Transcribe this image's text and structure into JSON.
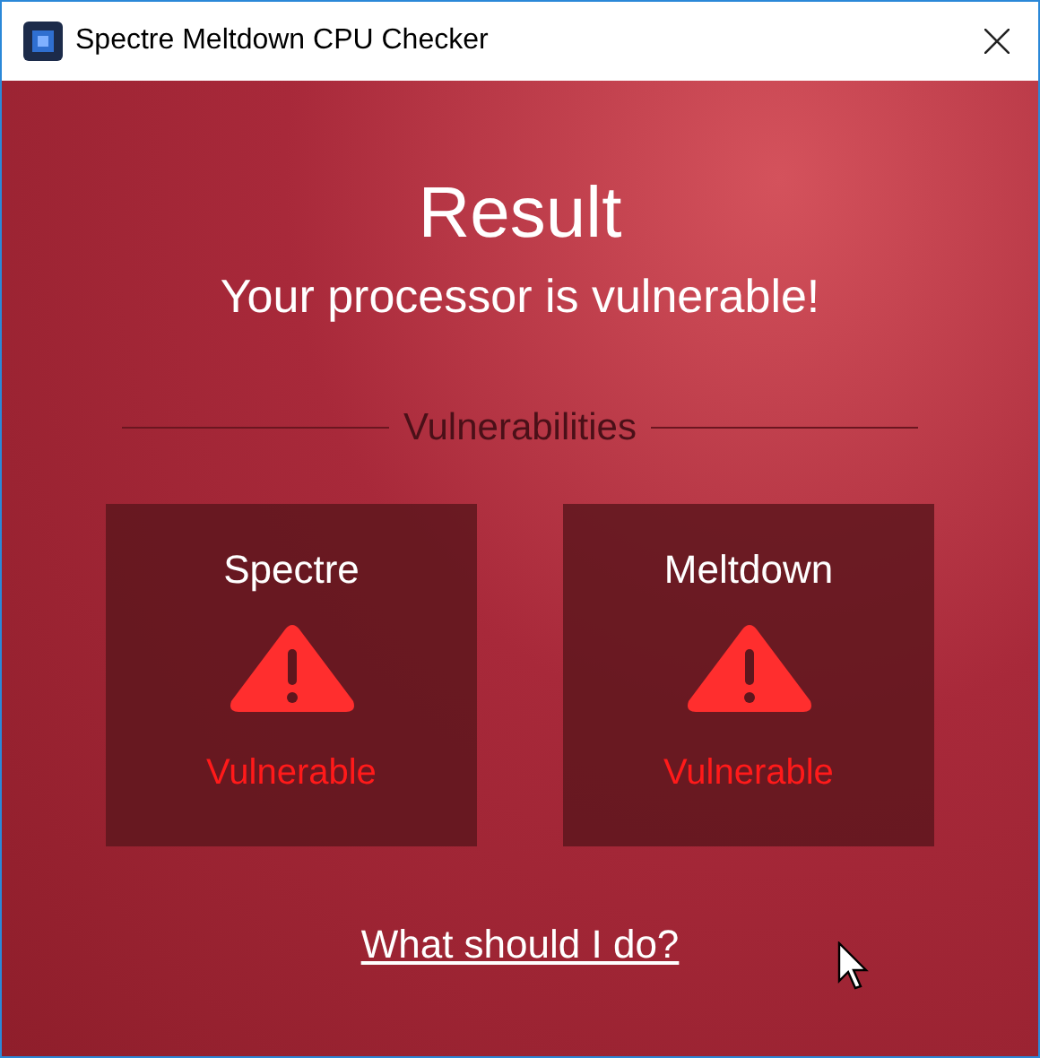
{
  "window": {
    "title": "Spectre Meltdown CPU Checker"
  },
  "result": {
    "heading": "Result",
    "message": "Your processor is vulnerable!"
  },
  "vulnerabilities": {
    "heading": "Vulnerabilities",
    "items": [
      {
        "name": "Spectre",
        "status": "Vulnerable",
        "vulnerable": true
      },
      {
        "name": "Meltdown",
        "status": "Vulnerable",
        "vulnerable": true
      }
    ]
  },
  "help_link": "What should I do?"
}
